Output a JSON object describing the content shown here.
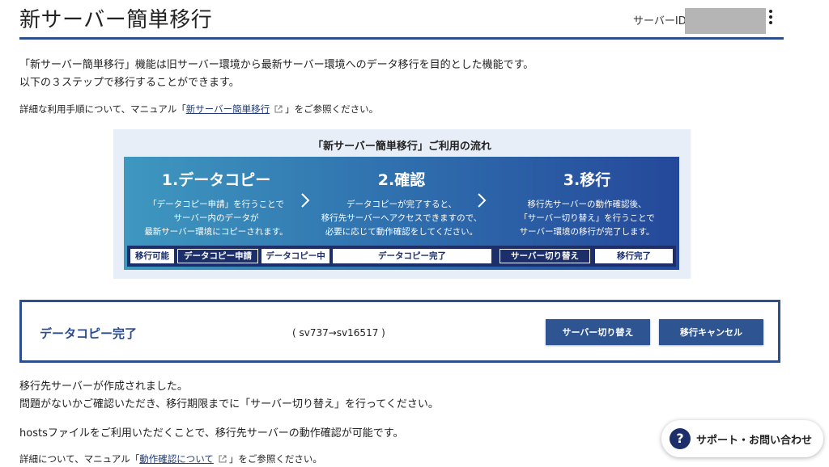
{
  "header": {
    "title": "新サーバー簡単移行",
    "server_id_label": "サーバーID"
  },
  "intro": {
    "line1": "「新サーバー簡単移行」機能は旧サーバー環境から最新サーバー環境へのデータ移行を目的とした機能です。",
    "line2": "以下の３ステップで移行することができます。"
  },
  "manual": {
    "prefix": "詳細な利用手順について、マニュアル「",
    "link": "新サーバー簡単移行",
    "suffix": "」をご参照ください。"
  },
  "flow": {
    "title": "「新サーバー簡単移行」ご利用の流れ",
    "steps": [
      {
        "title": "1.データコピー",
        "desc1": "「データコピー申請」を行うことで",
        "desc2": "サーバー内のデータが",
        "desc3": "最新サーバー環境にコピーされます。"
      },
      {
        "title": "2.確認",
        "desc1": "データコピーが完了すると、",
        "desc2": "移行先サーバーへアクセスできますので、",
        "desc3": "必要に応じて動作確認をしてください。"
      },
      {
        "title": "3.移行",
        "desc1": "移行先サーバーの動作確認後、",
        "desc2": "「サーバー切り替え」を行うことで",
        "desc3": "サーバー環境の移行が完了します。"
      }
    ],
    "bar": [
      "移行可能",
      "データコピー申請",
      "データコピー中",
      "データコピー完了",
      "サーバー切り替え",
      "移行完了"
    ]
  },
  "status": {
    "title": "データコピー完了",
    "servers": "( sv737→sv16517 )",
    "switch_button": "サーバー切り替え",
    "cancel_button": "移行キャンセル"
  },
  "after": {
    "line1": "移行先サーバーが作成されました。",
    "line2": "問題がないかご確認いただき、移行期限までに「サーバー切り替え」を行ってください。",
    "hosts": "hostsファイルをご利用いただくことで、移行先サーバーの動作確認が可能です。",
    "detail_prefix": "詳細について、マニュアル「",
    "detail_link": "動作確認について",
    "detail_suffix": "」をご参照ください。"
  },
  "support": {
    "icon": "?",
    "label": "サポート・お問い合わせ"
  },
  "colors": {
    "accent": "#2e4f8f",
    "button": "#2e5592",
    "bar_dark": "#1c2f6b"
  }
}
